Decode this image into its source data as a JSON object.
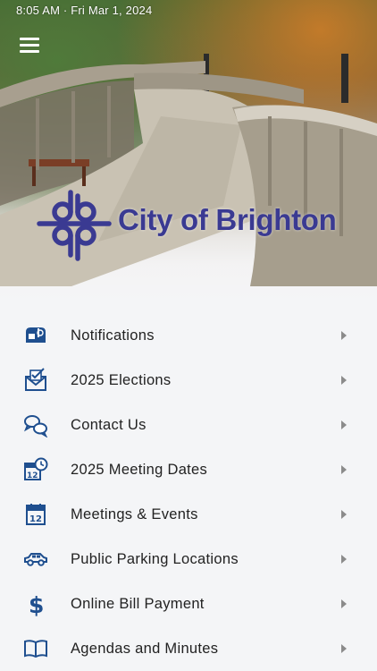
{
  "status_bar": {
    "text": "8:05 AM · Fri Mar 1, 2024"
  },
  "header": {
    "logo_text": "City of Brighton"
  },
  "colors": {
    "brand": "#3a3a92",
    "icon": "#1f4f8f",
    "chevron": "#8b8b8b",
    "background": "#f4f5f7"
  },
  "menu": {
    "items": [
      {
        "label": "Notifications",
        "icon": "mailbox-icon"
      },
      {
        "label": "2025 Elections",
        "icon": "ballot-envelope-icon"
      },
      {
        "label": "Contact Us",
        "icon": "chat-bubbles-icon"
      },
      {
        "label": "2025 Meeting Dates",
        "icon": "calendar-clock-icon"
      },
      {
        "label": "Meetings & Events",
        "icon": "calendar-icon"
      },
      {
        "label": "Public Parking Locations",
        "icon": "car-icon"
      },
      {
        "label": "Online Bill Payment",
        "icon": "dollar-icon"
      },
      {
        "label": "Agendas and Minutes",
        "icon": "book-icon"
      }
    ]
  }
}
